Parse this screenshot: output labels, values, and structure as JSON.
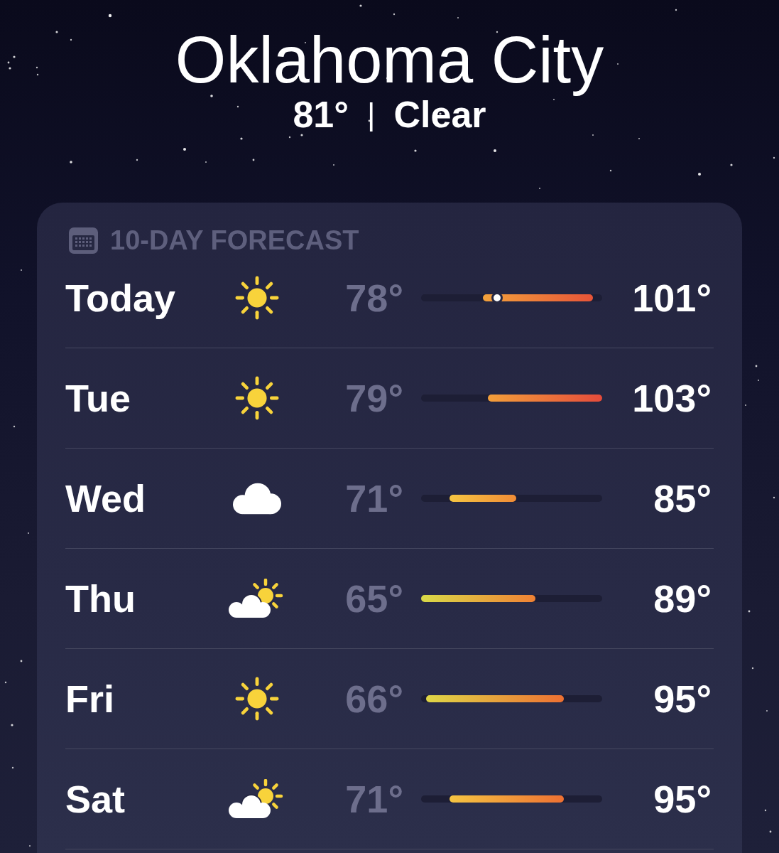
{
  "location": {
    "city": "Oklahoma City",
    "temperature": "81°",
    "separator": "|",
    "condition": "Clear"
  },
  "forecast": {
    "title": "10-DAY FORECAST",
    "days": [
      {
        "day": "Today",
        "kind": "sunny",
        "low": "78°",
        "high": "101°",
        "now_marker": true
      },
      {
        "day": "Tue",
        "kind": "sunny",
        "low": "79°",
        "high": "103°",
        "now_marker": false
      },
      {
        "day": "Wed",
        "kind": "cloudy",
        "low": "71°",
        "high": "85°",
        "now_marker": false
      },
      {
        "day": "Thu",
        "kind": "partly-cloudy",
        "low": "65°",
        "high": "89°",
        "now_marker": false
      },
      {
        "day": "Fri",
        "kind": "sunny",
        "low": "66°",
        "high": "95°",
        "now_marker": false
      },
      {
        "day": "Sat",
        "kind": "partly-cloudy",
        "low": "71°",
        "high": "95°",
        "now_marker": false
      }
    ]
  }
}
